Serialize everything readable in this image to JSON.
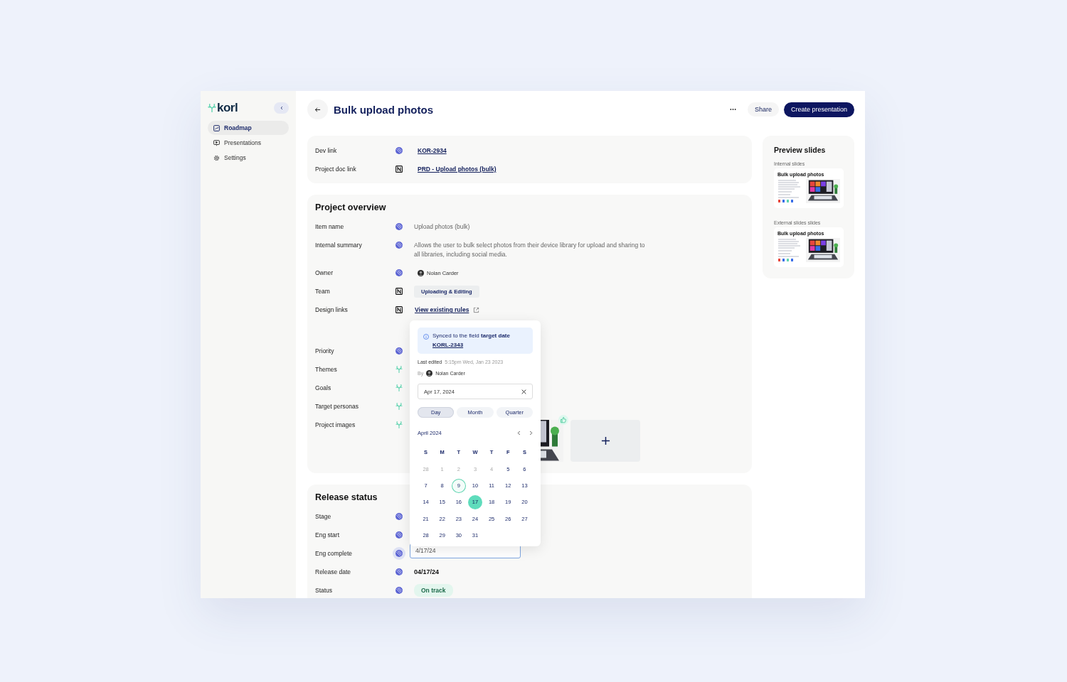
{
  "sidebar": {
    "logo": "korl",
    "items": [
      {
        "label": "Roadmap",
        "kind": "roadmap",
        "selected": true
      },
      {
        "label": "Presentations",
        "kind": "presentations",
        "selected": false
      },
      {
        "label": "Settings",
        "kind": "settings",
        "selected": false
      }
    ]
  },
  "header": {
    "title": "Bulk upload photos",
    "share": "Share",
    "create": "Create presentation"
  },
  "links": {
    "rows": [
      {
        "label": "Dev link",
        "source": {
          "kind": "linear"
        },
        "value": "KOR-2934"
      },
      {
        "label": "Project doc link",
        "source": {
          "kind": "notion"
        },
        "value": "PRD - Upload photos (bulk)"
      }
    ]
  },
  "overview": {
    "title": "Project overview",
    "rows": [
      {
        "label": "Item name",
        "source": {
          "kind": "linear"
        },
        "kind": "text",
        "value": "Upload photos (bulk)"
      },
      {
        "label": "Internal summary",
        "source": {
          "kind": "linear"
        },
        "kind": "text",
        "value": "Allows the user to bulk select photos from their device library for upload and sharing to all libraries, including social media."
      },
      {
        "label": "Owner",
        "source": {
          "kind": "linear"
        },
        "kind": "person",
        "value": "Nolan Carder"
      },
      {
        "label": "Team",
        "source": {
          "kind": "notion"
        },
        "kind": "tag",
        "value": "Uploading & Editing"
      },
      {
        "label": "Design links",
        "source": {
          "kind": "notion"
        },
        "kind": "link",
        "value": "View existing rules"
      },
      {
        "label": "Priority",
        "source": {
          "kind": "linear"
        },
        "kind": "empty"
      },
      {
        "label": "Themes",
        "source": {
          "kind": "korl"
        },
        "kind": "empty"
      },
      {
        "label": "Goals",
        "source": {
          "kind": "korl"
        },
        "kind": "empty"
      },
      {
        "label": "Target personas",
        "source": {
          "kind": "korl"
        },
        "kind": "empty"
      },
      {
        "label": "Project images",
        "source": {
          "kind": "korl"
        },
        "kind": "images",
        "images": [
          {
            "kind": "picture",
            "liked": true
          }
        ]
      }
    ]
  },
  "release": {
    "title": "Release status",
    "rows": [
      {
        "label": "Stage",
        "source": {
          "kind": "linear"
        },
        "kind": "empty",
        "focused": false
      },
      {
        "label": "Eng start",
        "source": {
          "kind": "linear"
        },
        "kind": "empty",
        "focused": false
      },
      {
        "label": "Eng complete",
        "source": {
          "kind": "linear"
        },
        "kind": "field",
        "value": "4/17/24",
        "focused": true
      },
      {
        "label": "Release date",
        "source": {
          "kind": "linear"
        },
        "kind": "strong",
        "value": "04/17/24",
        "focused": false
      },
      {
        "label": "Status",
        "source": {
          "kind": "linear"
        },
        "kind": "status",
        "value": "On track",
        "focused": false
      }
    ]
  },
  "popup": {
    "sync_note": "Synced to the field **target date**",
    "sync_link": "KORL-2343",
    "edited_label": "Last edited",
    "edited_time": "5:15pm Wed, Jan 23 2023",
    "by_label": "By",
    "by_name": "Nolan Carder",
    "date_value": "Apr 17, 2024",
    "modes": [
      {
        "label": "Day",
        "selected": true
      },
      {
        "label": "Month",
        "selected": false
      },
      {
        "label": "Quarter",
        "selected": false
      }
    ],
    "month": "April 2024",
    "weekdays": [
      "S",
      "M",
      "T",
      "W",
      "T",
      "F",
      "S"
    ],
    "days": [
      {
        "label": "28",
        "muted": true,
        "today": false,
        "selected": false
      },
      {
        "label": "1",
        "muted": true,
        "today": false,
        "selected": false
      },
      {
        "label": "2",
        "muted": true,
        "today": false,
        "selected": false
      },
      {
        "label": "3",
        "muted": true,
        "today": false,
        "selected": false
      },
      {
        "label": "4",
        "muted": true,
        "today": false,
        "selected": false
      },
      {
        "label": "5",
        "muted": false,
        "today": false,
        "selected": false
      },
      {
        "label": "6",
        "muted": false,
        "today": false,
        "selected": false
      },
      {
        "label": "7",
        "muted": false,
        "today": false,
        "selected": false
      },
      {
        "label": "8",
        "muted": false,
        "today": false,
        "selected": false
      },
      {
        "label": "9",
        "muted": false,
        "today": true,
        "selected": false
      },
      {
        "label": "10",
        "muted": false,
        "today": false,
        "selected": false
      },
      {
        "label": "11",
        "muted": false,
        "today": false,
        "selected": false
      },
      {
        "label": "12",
        "muted": false,
        "today": false,
        "selected": false
      },
      {
        "label": "13",
        "muted": false,
        "today": false,
        "selected": false
      },
      {
        "label": "14",
        "muted": false,
        "today": false,
        "selected": false
      },
      {
        "label": "15",
        "muted": false,
        "today": false,
        "selected": false
      },
      {
        "label": "16",
        "muted": false,
        "today": false,
        "selected": false
      },
      {
        "label": "17",
        "muted": false,
        "today": false,
        "selected": true
      },
      {
        "label": "18",
        "muted": false,
        "today": false,
        "selected": false
      },
      {
        "label": "19",
        "muted": false,
        "today": false,
        "selected": false
      },
      {
        "label": "20",
        "muted": false,
        "today": false,
        "selected": false
      },
      {
        "label": "21",
        "muted": false,
        "today": false,
        "selected": false
      },
      {
        "label": "22",
        "muted": false,
        "today": false,
        "selected": false
      },
      {
        "label": "23",
        "muted": false,
        "today": false,
        "selected": false
      },
      {
        "label": "24",
        "muted": false,
        "today": false,
        "selected": false
      },
      {
        "label": "25",
        "muted": false,
        "today": false,
        "selected": false
      },
      {
        "label": "26",
        "muted": false,
        "today": false,
        "selected": false
      },
      {
        "label": "27",
        "muted": false,
        "today": false,
        "selected": false
      },
      {
        "label": "28",
        "muted": false,
        "today": false,
        "selected": false
      },
      {
        "label": "29",
        "muted": false,
        "today": false,
        "selected": false
      },
      {
        "label": "30",
        "muted": false,
        "today": false,
        "selected": false
      },
      {
        "label": "31",
        "muted": false,
        "today": false,
        "selected": false
      }
    ]
  },
  "preview": {
    "title": "Preview slides",
    "groups": [
      {
        "label": "Internal slides",
        "slide_title": "Bulk upload photos"
      },
      {
        "label": "External slides slides",
        "slide_title": "Bulk upload photos"
      }
    ]
  }
}
